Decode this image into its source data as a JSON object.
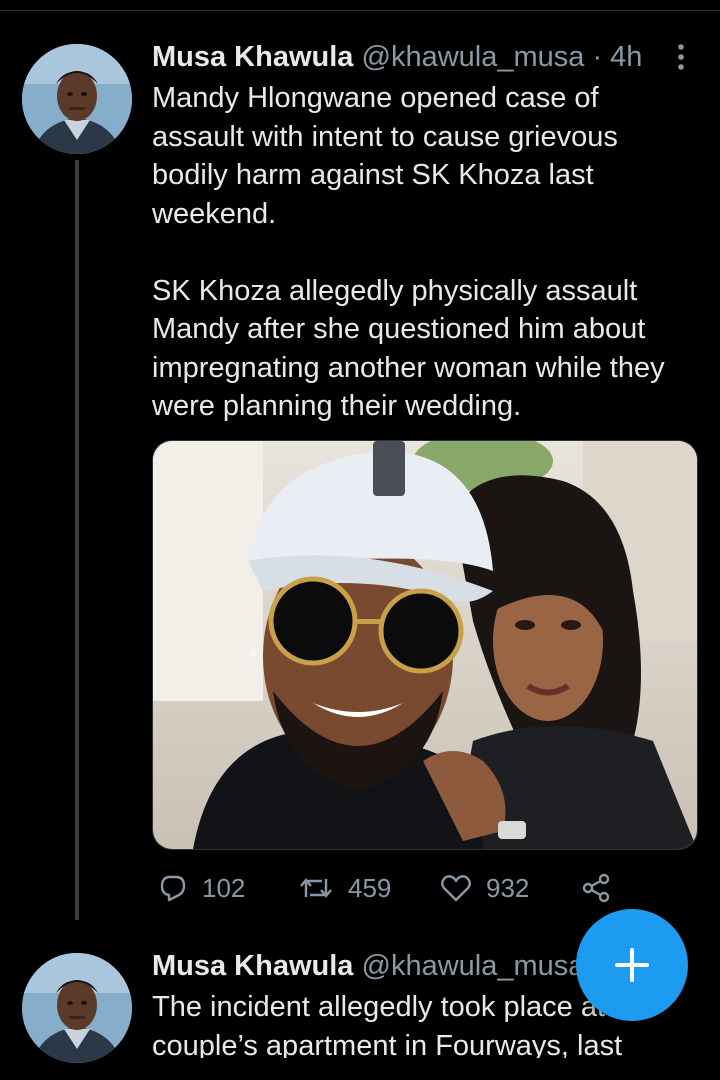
{
  "tweets": [
    {
      "name": "Musa Khawula",
      "handle": "@khawula_musa",
      "separator": " · ",
      "time": "4h",
      "text": "Mandy Hlongwane opened case of assault with intent to cause grievous bodily harm against SK Khoza last weekend.\n\nSK Khoza allegedly physically assault Mandy after she questioned him about impregnating another woman while they were planning their wedding.",
      "replies": "102",
      "retweets": "459",
      "likes": "932"
    },
    {
      "name": "Musa Khawula",
      "handle": "@khawula_musa",
      "text": "The incident allegedly took place at the couple’s apartment in Fourways, last"
    }
  ],
  "icons": {
    "more": "more-vertical-icon",
    "reply": "reply-icon",
    "retweet": "retweet-icon",
    "like": "heart-icon",
    "share": "share-icon",
    "compose": "plus-icon"
  },
  "colors": {
    "background": "#000000",
    "text": "#e7e9ea",
    "muted": "#8b98a5",
    "accent": "#1d9bf0"
  }
}
